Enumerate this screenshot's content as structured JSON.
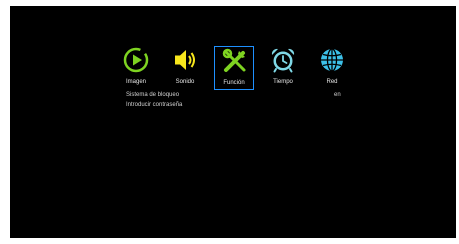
{
  "menu": {
    "items": [
      {
        "label": "Imagen",
        "icon": "play-circle-icon",
        "color": "#7ed321"
      },
      {
        "label": "Sonido",
        "icon": "speaker-icon",
        "color": "#f8e71c"
      },
      {
        "label": "Función",
        "icon": "tools-icon",
        "color": "#7ed321",
        "selected": true
      },
      {
        "label": "Tiempo",
        "icon": "alarm-clock-icon",
        "color": "#7fd8e6"
      },
      {
        "label": "Red",
        "icon": "globe-icon",
        "color": "#3cc0e8"
      }
    ],
    "selection_color": "#1e90ff"
  },
  "settings": {
    "lock_system": {
      "label": "Sistema de bloqueo",
      "value": "en"
    },
    "password": {
      "label": "Introducir contraseña"
    }
  }
}
